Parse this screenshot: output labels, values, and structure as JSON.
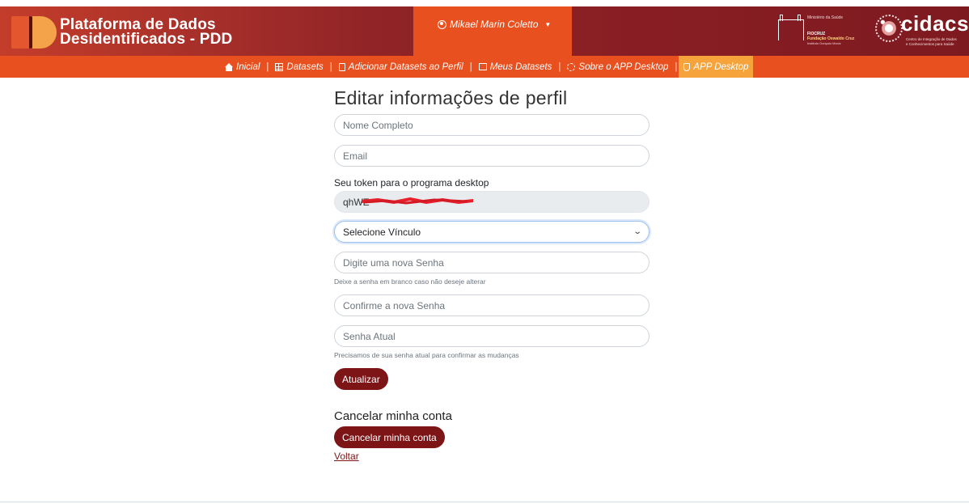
{
  "header": {
    "brand_line1": "Plataforma de Dados",
    "brand_line2": "Desidentificados - PDD",
    "user_name": "Mikael Marin Coletto",
    "ministry": {
      "line1": "Ministério da Saúde",
      "line2": "FIOCRUZ",
      "line3": "Fundação Oswaldo Cruz",
      "line4": "Instituto Gonçalo Moniz"
    },
    "cidacs": {
      "word": "cidacs",
      "sub1": "Centro de Integração de Dados",
      "sub2": "e Conhecimentos para Saúde"
    }
  },
  "nav": {
    "items": [
      {
        "label": "Inicial",
        "icon": "home-icon"
      },
      {
        "label": "Datasets",
        "icon": "table-icon"
      },
      {
        "label": "Adicionar Datasets ao Perfil",
        "icon": "file-icon"
      },
      {
        "label": "Meus Datasets",
        "icon": "pencil-icon"
      },
      {
        "label": "Sobre o APP Desktop",
        "icon": "gear-icon"
      },
      {
        "label": "APP Desktop",
        "icon": "shield-icon",
        "active": true
      }
    ],
    "separator": "|"
  },
  "form": {
    "title": "Editar informações de perfil",
    "name_placeholder": "Nome Completo",
    "email_placeholder": "Email",
    "token_label": "Seu token para o programa desktop",
    "token_value": "qhWE",
    "select_value": "Selecione Vínculo",
    "new_password_placeholder": "Digite uma nova Senha",
    "new_password_help": "Deixe a senha em branco caso não deseje alterar",
    "confirm_password_placeholder": "Confirme a nova Senha",
    "current_password_placeholder": "Senha Atual",
    "current_password_help": "Precisamos de sua senha atual para confirmar as mudanças",
    "update_button": "Atualizar"
  },
  "cancel": {
    "title": "Cancelar minha conta",
    "button": "Cancelar minha conta",
    "back_link": "Voltar"
  },
  "colors": {
    "header_dark": "#8a1f24",
    "nav_orange": "#e8511f",
    "nav_active": "#f6a33b",
    "button": "#7d1416"
  }
}
